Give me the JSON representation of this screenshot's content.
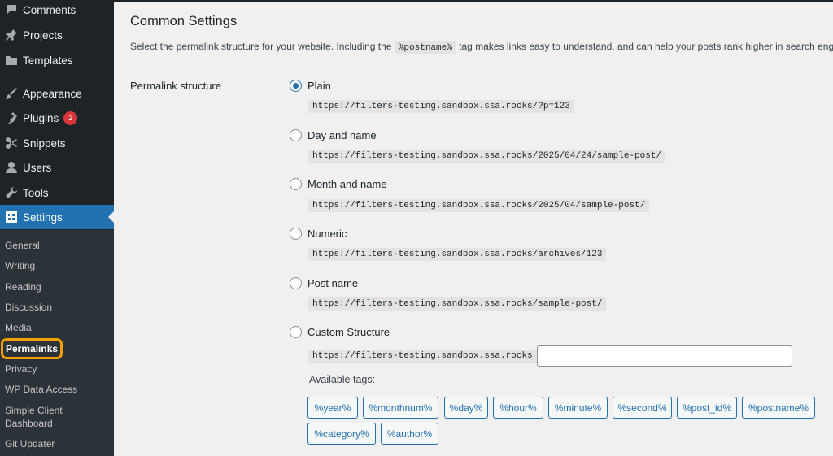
{
  "sidebar": {
    "items": [
      {
        "label": "Comments",
        "icon": "comments-icon"
      },
      {
        "label": "Projects",
        "icon": "pin-icon"
      },
      {
        "label": "Templates",
        "icon": "folder-icon"
      },
      {
        "label": "Appearance",
        "icon": "brush-icon"
      },
      {
        "label": "Plugins",
        "icon": "plug-icon",
        "badge": "2"
      },
      {
        "label": "Snippets",
        "icon": "scissors-icon"
      },
      {
        "label": "Users",
        "icon": "user-icon"
      },
      {
        "label": "Tools",
        "icon": "wrench-icon"
      },
      {
        "label": "Settings",
        "icon": "settings-icon",
        "active": true
      }
    ],
    "submenu": [
      "General",
      "Writing",
      "Reading",
      "Discussion",
      "Media",
      "Permalinks",
      "Privacy",
      "WP Data Access",
      "Simple Client Dashboard",
      "Git Updater"
    ],
    "current_submenu": "Permalinks"
  },
  "main": {
    "title": "Common Settings",
    "description_before": "Select the permalink structure for your website. Including the ",
    "description_code": "%postname%",
    "description_after": " tag makes links easy to understand, and can help your posts rank higher in search engines.",
    "structure_label": "Permalink structure",
    "options": [
      {
        "label": "Plain",
        "sample": "https://filters-testing.sandbox.ssa.rocks/?p=123",
        "checked": true
      },
      {
        "label": "Day and name",
        "sample": "https://filters-testing.sandbox.ssa.rocks/2025/04/24/sample-post/"
      },
      {
        "label": "Month and name",
        "sample": "https://filters-testing.sandbox.ssa.rocks/2025/04/sample-post/"
      },
      {
        "label": "Numeric",
        "sample": "https://filters-testing.sandbox.ssa.rocks/archives/123"
      },
      {
        "label": "Post name",
        "sample": "https://filters-testing.sandbox.ssa.rocks/sample-post/"
      },
      {
        "label": "Custom Structure",
        "sample": "https://filters-testing.sandbox.ssa.rocks"
      }
    ],
    "custom_value": "",
    "available_tags_label": "Available tags:",
    "tags": [
      "%year%",
      "%monthnum%",
      "%day%",
      "%hour%",
      "%minute%",
      "%second%",
      "%post_id%",
      "%postname%",
      "%category%",
      "%author%"
    ]
  },
  "colors": {
    "accent": "#2271b1",
    "sidebar": "#1d2327",
    "highlight": "#f0a000",
    "badge": "#d63638"
  }
}
